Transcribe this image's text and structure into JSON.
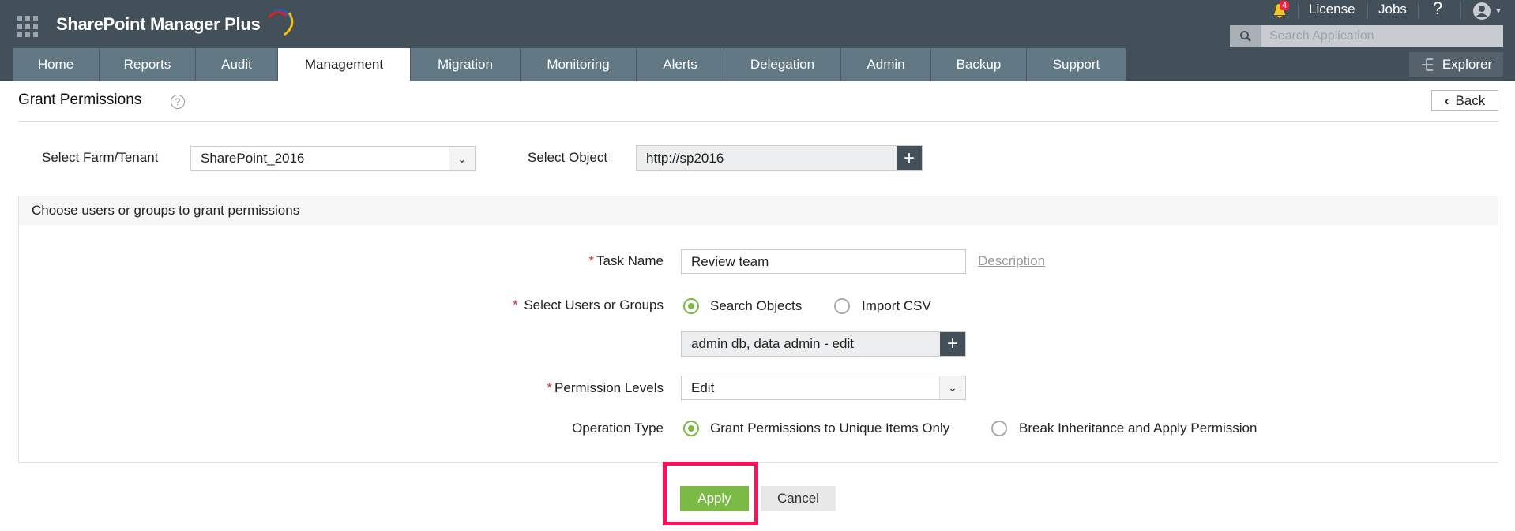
{
  "app": {
    "title": "SharePoint Manager Plus",
    "notification_count": "4",
    "license": "License",
    "jobs": "Jobs",
    "help": "?",
    "search_placeholder": "Search Application",
    "explorer": "Explorer"
  },
  "tabs": [
    {
      "label": "Home"
    },
    {
      "label": "Reports"
    },
    {
      "label": "Audit"
    },
    {
      "label": "Management",
      "active": true
    },
    {
      "label": "Migration"
    },
    {
      "label": "Monitoring"
    },
    {
      "label": "Alerts"
    },
    {
      "label": "Delegation"
    },
    {
      "label": "Admin"
    },
    {
      "label": "Backup"
    },
    {
      "label": "Support"
    }
  ],
  "page": {
    "title": "Grant Permissions",
    "help": "?",
    "back": "Back"
  },
  "filters": {
    "farm_label": "Select Farm/Tenant",
    "farm_value": "SharePoint_2016",
    "object_label": "Select Object",
    "object_value": "http://sp2016"
  },
  "panel": {
    "heading": "Choose users or groups to grant permissions",
    "task_label": "Task Name",
    "task_value": "Review team",
    "description_link": "Description",
    "users_label": "Select Users or Groups",
    "search_objects": "Search Objects",
    "import_csv": "Import CSV",
    "users_value": "admin db, data admin - edit",
    "perm_label": "Permission Levels",
    "perm_value": "Edit",
    "op_label": "Operation Type",
    "op_unique": "Grant Permissions to Unique Items Only",
    "op_break": "Break Inheritance and Apply Permission",
    "required": "*"
  },
  "actions": {
    "apply": "Apply",
    "cancel": "Cancel"
  },
  "colors": {
    "header": "#434f59",
    "tab": "#627985",
    "accent": "#7cba46",
    "highlight": "#ff1155"
  }
}
